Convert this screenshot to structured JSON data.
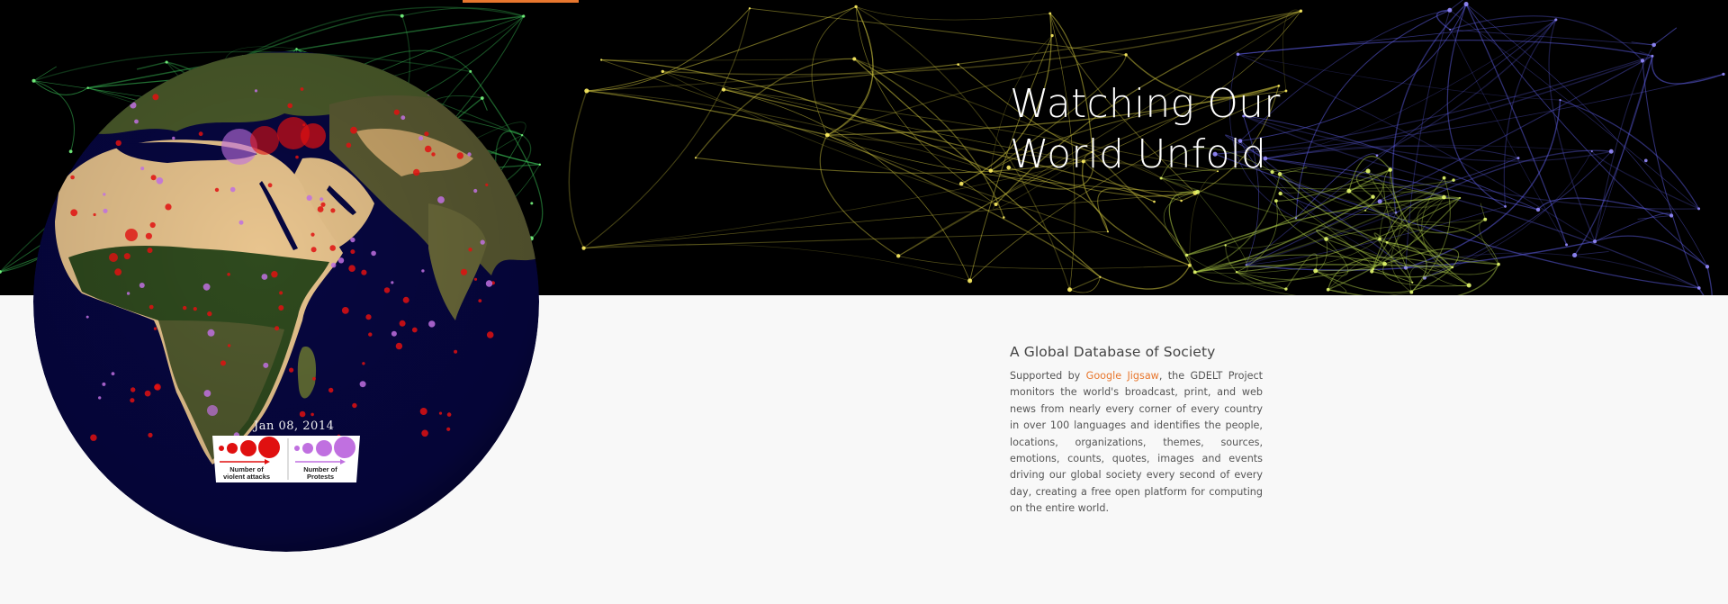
{
  "hero": {
    "title_line1": "Watching Our",
    "title_line2": "World Unfold"
  },
  "globe": {
    "date": "Jan 08, 2014",
    "legend": {
      "attacks_label": "Number of violent attacks",
      "protests_label": "Number of Protests",
      "attacks_color": "#e01010",
      "protests_color": "#c070e0"
    }
  },
  "about": {
    "heading": "A Global Database of Society",
    "text_before_link": "Supported by ",
    "link_text": "Google Jigsaw",
    "text_after_link": ", the GDELT Project monitors the world's broadcast, print, and web news from nearly every corner of every country in over 100 languages and identifies the people, locations, organizations, themes, sources, emotions, counts, quotes, images and events driving our global society every second of every day, creating a free open platform for computing on the entire world."
  },
  "colors": {
    "accent": "#e8772e",
    "hero_background": "#000000",
    "page_background": "#f8f8f8",
    "ocean": "#060640"
  }
}
